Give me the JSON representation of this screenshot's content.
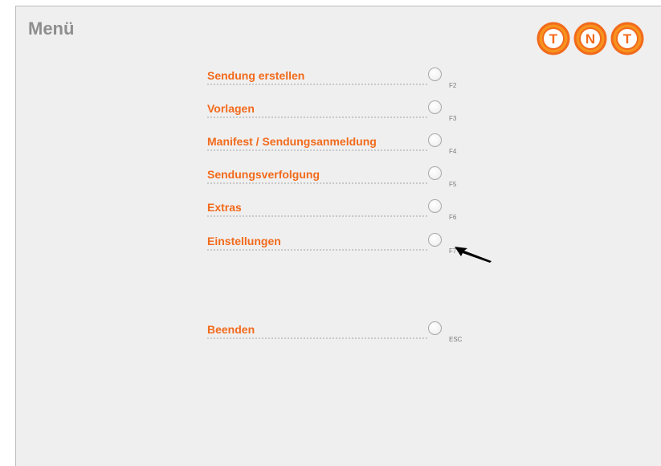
{
  "header": {
    "title": "Menü"
  },
  "logo": {
    "letters": [
      "T",
      "N",
      "T"
    ],
    "brand_color": "#f26a1b",
    "accent_color": "#f7931e"
  },
  "menu": {
    "items": [
      {
        "label": "Sendung erstellen",
        "key": "F2"
      },
      {
        "label": "Vorlagen",
        "key": "F3"
      },
      {
        "label": "Manifest / Sendungsanmeldung",
        "key": "F4"
      },
      {
        "label": "Sendungsverfolgung",
        "key": "F5"
      },
      {
        "label": "Extras",
        "key": "F6"
      },
      {
        "label": "Einstellungen",
        "key": "F7"
      }
    ],
    "exit": {
      "label": "Beenden",
      "key": "ESC"
    }
  },
  "colors": {
    "menu_text": "#f26a1b",
    "background": "#efefef",
    "title_text": "#8e8e8e"
  },
  "icons": {
    "pointer": "arrow-pointer-icon",
    "radio": "radio-circle-icon"
  }
}
